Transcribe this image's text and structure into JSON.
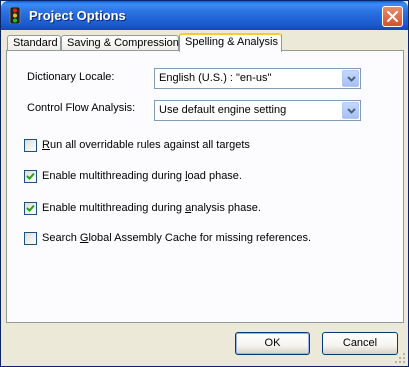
{
  "window": {
    "title": "Project Options"
  },
  "tabs": [
    {
      "label": "Standard",
      "selected": false
    },
    {
      "label": "Saving & Compression",
      "selected": false
    },
    {
      "label": "Spelling & Analysis",
      "selected": true
    }
  ],
  "fields": {
    "dictionary_locale": {
      "label": "Dictionary Locale:",
      "value": "English (U.S.) : \"en-us\""
    },
    "control_flow": {
      "label": "Control Flow Analysis:",
      "value": "Use default engine setting"
    }
  },
  "options": [
    {
      "pre": "",
      "key": "R",
      "post": "un all overridable rules against all targets",
      "checked": false
    },
    {
      "pre": "Enable multithreading during ",
      "key": "l",
      "post": "oad phase.",
      "checked": true
    },
    {
      "pre": "Enable multithreading during ",
      "key": "a",
      "post": "nalysis phase.",
      "checked": true
    },
    {
      "pre": "Search ",
      "key": "G",
      "post": "lobal Assembly Cache for missing references.",
      "checked": false
    }
  ],
  "buttons": {
    "ok": "OK",
    "cancel": "Cancel"
  },
  "colors": {
    "titlebar": "#0a5fd8",
    "dialog_bg": "#ece9d8",
    "check": "#21a121",
    "close": "#d2522b"
  }
}
